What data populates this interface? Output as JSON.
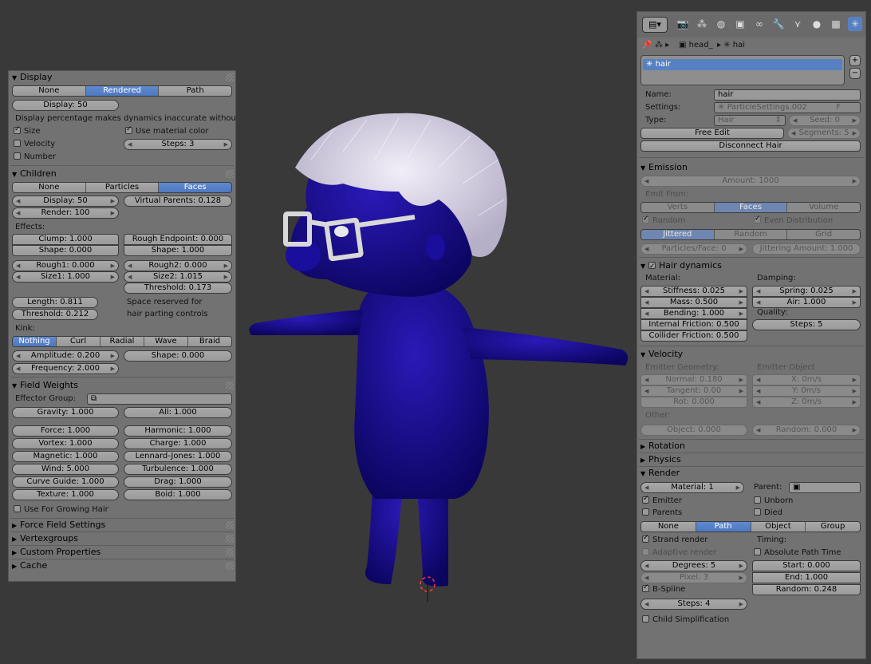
{
  "left": {
    "display": {
      "title": "Display",
      "modes": [
        "None",
        "Rendered",
        "Path"
      ],
      "display_field": "Display: 50",
      "warning": "Display percentage makes dynamics inaccurate without b",
      "size_label": "Size",
      "velocity_label": "Velocity",
      "number_label": "Number",
      "use_material_color": "Use material color",
      "steps": "Steps: 3"
    },
    "children": {
      "title": "Children",
      "modes": [
        "None",
        "Particles",
        "Faces"
      ],
      "display": "Display: 50",
      "virtual_parents": "Virtual Parents: 0.128",
      "render": "Render: 100",
      "effects_label": "Effects:",
      "clump": "Clump: 1.000",
      "rough_endpoint": "Rough Endpoint: 0.000",
      "shape1": "Shape: 0.000",
      "shape2": "Shape: 1.000",
      "rough1": "Rough1: 0.000",
      "rough2": "Rough2: 0.000",
      "size1": "Size1: 1.000",
      "size2": "Size2: 1.015",
      "threshold1": "Threshold: 0.173",
      "length": "Length: 0.811",
      "threshold2": "Threshold: 0.212",
      "space_note1": "Space reserved for",
      "space_note2": "hair parting controls",
      "kink_label": "Kink:",
      "kink_modes": [
        "Nothing",
        "Curl",
        "Radial",
        "Wave",
        "Braid"
      ],
      "amplitude": "Amplitude: 0.200",
      "kink_shape": "Shape: 0.000",
      "frequency": "Frequency: 2.000"
    },
    "field_weights": {
      "title": "Field Weights",
      "effector_group": "Effector Group:",
      "gravity": "Gravity: 1.000",
      "all": "All: 1.000",
      "force": "Force: 1.000",
      "harmonic": "Harmonic: 1.000",
      "vortex": "Vortex: 1.000",
      "charge": "Charge: 1.000",
      "magnetic": "Magnetic: 1.000",
      "lennard_jones": "Lennard-Jones: 1.000",
      "wind": "Wind: 5.000",
      "turbulence": "Turbulence: 1.000",
      "curve_guide": "Curve Guide: 1.000",
      "drag": "Drag: 1.000",
      "texture": "Texture: 1.000",
      "boid": "Boid: 1.000",
      "use_growing": "Use For Growing Hair"
    },
    "collapsed": [
      "Force Field Settings",
      "Vertexgroups",
      "Custom Properties",
      "Cache"
    ]
  },
  "right": {
    "breadcrumb": [
      "head_",
      "hai"
    ],
    "list_item": "hair",
    "name_label": "Name:",
    "name_value": "hair",
    "settings_label": "Settings:",
    "settings_value": "ParticleSettings.002",
    "settings_f": "F",
    "type_label": "Type:",
    "type_value": "Hair",
    "seed": "Seed: 0",
    "free_edit": "Free Edit",
    "segments": "Segments: 5",
    "disconnect": "Disconnect Hair",
    "emission": {
      "title": "Emission",
      "amount": "Amount: 1000",
      "emit_from": "Emit From:",
      "from_modes": [
        "Verts",
        "Faces",
        "Volume"
      ],
      "random": "Random",
      "even": "Even Distribution",
      "dist_modes": [
        "Jittered",
        "Random",
        "Grid"
      ],
      "particles_face": "Particles/Face: 0",
      "jittering": "Jittering Amount: 1.000"
    },
    "hair_dynamics": {
      "title": "Hair dynamics",
      "material": "Material:",
      "damping": "Damping:",
      "stiffness": "Stiffness: 0.025",
      "spring": "Spring: 0.025",
      "mass": "Mass: 0.500",
      "air": "Air: 1.000",
      "bending": "Bending: 1.000",
      "quality": "Quality:",
      "internal_friction": "Internal Friction: 0.500",
      "steps": "Steps: 5",
      "collider_friction": "Collider Friction: 0.500"
    },
    "velocity": {
      "title": "Velocity",
      "emitter_geometry": "Emitter Geometry:",
      "emitter_object": "Emitter Object",
      "normal": "Normal: 0.180",
      "x": "X: 0m/s",
      "tangent": "Tangent: 0.00",
      "y": "Y: 0m/s",
      "rot": "Rot: 0.000",
      "z": "Z: 0m/s",
      "other": "Other:",
      "object": "Object: 0.000",
      "random": "Random: 0.000"
    },
    "collapsed": [
      "Rotation",
      "Physics"
    ],
    "render": {
      "title": "Render",
      "material": "Material: 1",
      "parent": "Parent:",
      "emitter": "Emitter",
      "unborn": "Unborn",
      "parents": "Parents",
      "died": "Died",
      "modes": [
        "None",
        "Path",
        "Object",
        "Group"
      ],
      "strand_render": "Strand render",
      "timing": "Timing:",
      "adaptive_render": "Adaptive render",
      "absolute_path_time": "Absolute Path Time",
      "degrees": "Degrees: 5",
      "start": "Start: 0.000",
      "pixel": "Pixel: 3",
      "end": "End: 1.000",
      "bspline": "B-Spline",
      "random": "Random: 0.248",
      "steps": "Steps: 4",
      "child_simplification": "Child Simplification"
    }
  },
  "colors": {
    "background": "#393939",
    "panel": "#727272",
    "selection": "#5680c2",
    "body": "#1a0a8c",
    "hair": "#dcd6e6"
  }
}
